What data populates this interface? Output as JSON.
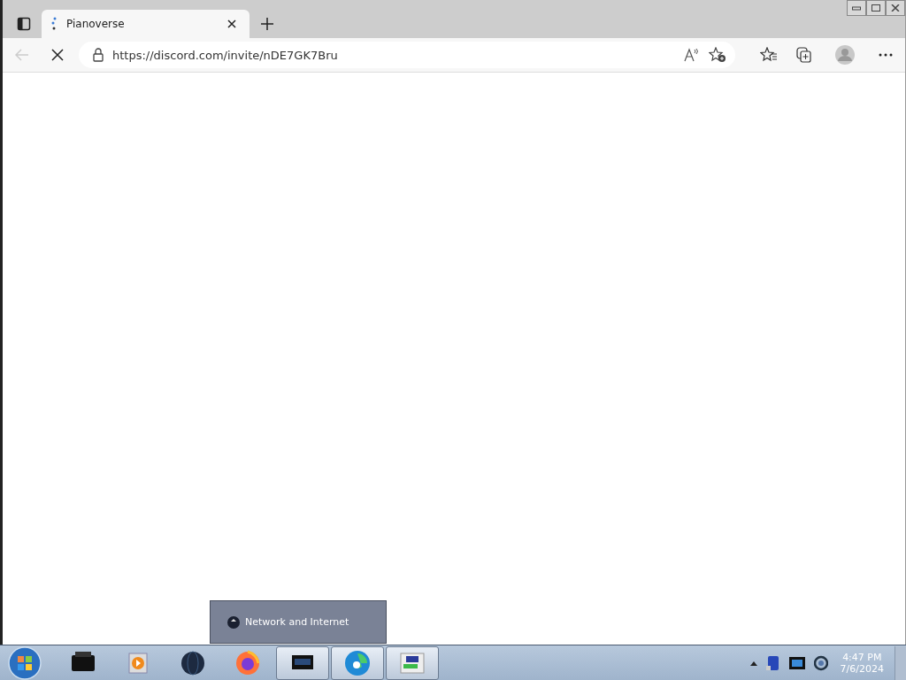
{
  "browser": {
    "tabs": [
      {
        "title": "Pianoverse",
        "selected": true
      }
    ],
    "address": {
      "url": "https://discord.com/invite/nDE7GK7Bru"
    },
    "loading": true
  },
  "tooltip": {
    "text": "Network and Internet"
  },
  "taskbar": {
    "apps": [
      {
        "running": false
      },
      {
        "running": false
      },
      {
        "running": false
      },
      {
        "running": false
      },
      {
        "running": true
      },
      {
        "running": true
      },
      {
        "running": true
      }
    ],
    "clock": {
      "time": "4:47 PM",
      "date": "7/6/2024"
    }
  }
}
